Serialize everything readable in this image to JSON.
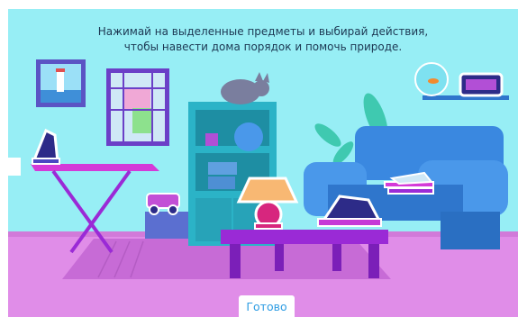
{
  "instruction": {
    "line1": "Нажимай на выделенные предметы и выбирай действия,",
    "line2": "чтобы навести дома порядок и помочь природе."
  },
  "done_button": {
    "label": "Готово"
  },
  "colors": {
    "wall": "#97eef5",
    "floor": "#e08de8",
    "rug": "#c76bd6",
    "furniture_purple": "#9a2ad6",
    "sofa_blue": "#3a88e0",
    "shelf_teal": "#2bb3c7",
    "lamp_shade": "#f8b873",
    "button_text": "#2f9de3",
    "highlight_outline": "#ffffff"
  },
  "interactive_items": [
    {
      "name": "iron",
      "icon": "iron-icon"
    },
    {
      "name": "toy-car",
      "icon": "toy-car-icon"
    },
    {
      "name": "table-lamp",
      "icon": "lamp-icon"
    },
    {
      "name": "laptop",
      "icon": "laptop-icon"
    },
    {
      "name": "magazines",
      "icon": "magazines-icon"
    },
    {
      "name": "digital-clock",
      "icon": "clock-icon"
    }
  ]
}
